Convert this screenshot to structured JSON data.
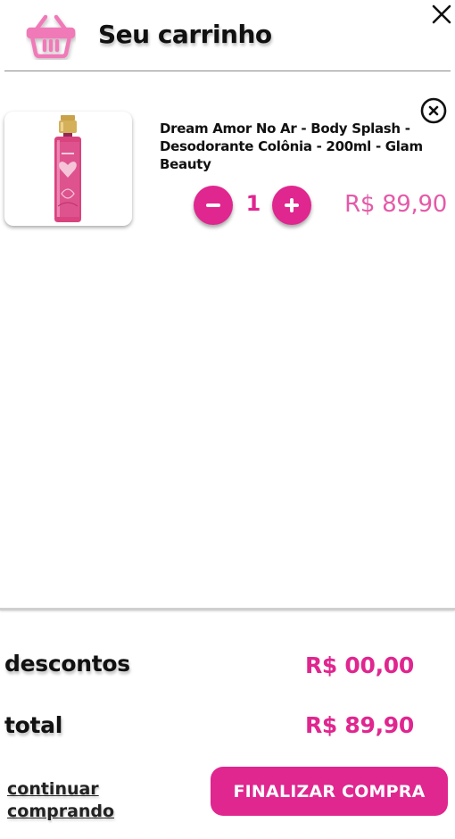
{
  "header": {
    "title": "Seu carrinho",
    "basket_icon": "shopping-basket-icon",
    "close_icon": "close-icon"
  },
  "item": {
    "name": "Dream Amor No Ar - Body Splash - Desodorante Colônia - 200ml - Glam Beauty",
    "quantity": "1",
    "price": "R$ 89,90",
    "remove_icon": "remove-circle-icon"
  },
  "summary": {
    "discounts_label": "descontos",
    "discounts_value": "R$ 00,00",
    "total_label": "total",
    "total_value": "R$ 89,90"
  },
  "actions": {
    "continue_line1": "continuar",
    "continue_line2": "comprando",
    "checkout_label": "FINALIZAR COMPRA"
  },
  "colors": {
    "accent": "#e0268f",
    "price": "#e45aa8",
    "basket": "#f07ab8"
  }
}
